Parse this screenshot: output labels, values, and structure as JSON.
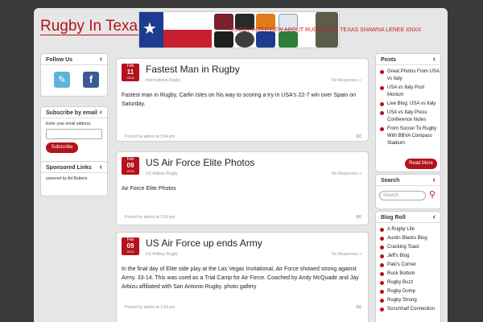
{
  "site": {
    "title": "Rugby In Texas"
  },
  "banner": {
    "ticker": "RUGBY INTERVIEW ABOUT RUGBY FOR TEXAS SHAWNA LENEE XNXX"
  },
  "left": {
    "follow_title": "Follow Us",
    "subscribe_title": "Subscribe by email",
    "email_label": "Enter your email address",
    "subscribe_button": "Subscribe",
    "sponsored_title": "Sponsored Links",
    "sponsored_text": "powered by Ad Buttons"
  },
  "posts": [
    {
      "month": "Feb",
      "day": "11",
      "year": "2013",
      "title": "Fastest Man in Rugby",
      "category": "International Rugby",
      "responses": "No Responses »",
      "body": "Fastest man in Rugby, Carlin Isles on his way to scoring a try in USA's 22-7 win over Spain on Saturday.",
      "footer": "Posted by admin at 3:54 pm"
    },
    {
      "month": "Feb",
      "day": "09",
      "year": "2013",
      "title": "US Air Force Elite Photos",
      "category": "US Military Rugby",
      "responses": "No Responses »",
      "body": "Air Force Elite Photos",
      "footer": "Posted by admin at 2:00 pm"
    },
    {
      "month": "Feb",
      "day": "09",
      "year": "2013",
      "title": "US Air Force up ends Army",
      "category": "US Military Rugby",
      "responses": "No Responses »",
      "body": "In the final day of Elite side play at the Las Vegas Invitational, Air Force showed strong against Army. 33-14. This was used as a Trial Camp for Air Force. Coached by Andy McQuade and Jay Arbizu affiliated with San Antonio Rugby. photo gallery",
      "footer": "Posted by admin at 1:55 pm"
    }
  ],
  "right": {
    "posts_title": "Posts",
    "posts": [
      "Great Photos From USA vs Italy",
      "USA vs Italy Post Mortum",
      "Live Blog: USA vs Italy",
      "USA vs Italy Press Conference Notes",
      "From Soccer To Rugby With BBVA Compass Stadium"
    ],
    "read_more": "Read More",
    "search_title": "Search",
    "search_placeholder": "Search",
    "blogroll_title": "Blog Roll",
    "blogroll": [
      "A Rugby Life",
      "Austin Blacks Blog",
      "Cracking Toast",
      "Jeff's Blog",
      "Paki's Corner",
      "Ruck Bottom",
      "Rugby Buzz",
      "Rugby Dump",
      "Rugby Strong",
      "Scrumhalf Connection"
    ]
  },
  "colors": {
    "accent": "#b5121b",
    "page": "#e6e6e6",
    "background": "#3a3a3a"
  }
}
